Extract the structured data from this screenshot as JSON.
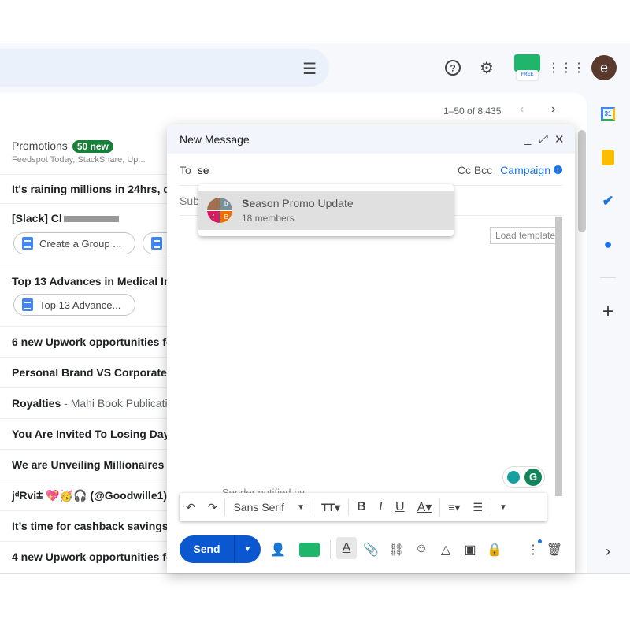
{
  "header": {
    "pager": "1–50 of 8,435",
    "avatar_letter": "e",
    "ext_badge": "FREE"
  },
  "promotions": {
    "label": "Promotions",
    "badge": "50 new",
    "senders": "Feedspot Today, StackShare, Up..."
  },
  "emails": [
    {
      "subject": "It's raining millions in 24hrs, d",
      "snippet": ""
    },
    {
      "subject": "[Slack] Cl",
      "snippet": "",
      "chips": [
        "Create a Group ...",
        ""
      ]
    },
    {
      "subject": "Top 13 Advances in Medical Im",
      "snippet": "",
      "chips": [
        "Top 13 Advance..."
      ]
    },
    {
      "subject": "6 new Upwork opportunities fo",
      "snippet": ""
    },
    {
      "subject": "Personal Brand VS Corporate B",
      "snippet": ""
    },
    {
      "subject": "Royalties",
      "snippet": " - Mahi Book Publicatio"
    },
    {
      "subject": "You Are Invited To Losing Dayl",
      "snippet": ""
    },
    {
      "subject": "We are Unveiling Millionaires i",
      "snippet": ""
    },
    {
      "subject": "jᵈRvi⩲ 💖🥳🎧 (@Goodwille1)",
      "snippet": ""
    },
    {
      "subject": "It’s time for cashback savings",
      "snippet": ""
    },
    {
      "subject": "4 new Upwork opportunities fo",
      "snippet": ""
    }
  ],
  "compose": {
    "title": "New Message",
    "to_label": "To",
    "to_value": "se",
    "cc_bcc": "Cc Bcc",
    "campaign": "Campaign",
    "subject_placeholder": "Subject",
    "load_template": "Load template",
    "notified": "Sender notified by",
    "font": "Sans Serif",
    "send": "Send"
  },
  "suggestion": {
    "match": "Se",
    "rest": "ason Promo Update",
    "members": "18 members",
    "avatar_letters": [
      "b",
      "f",
      "B"
    ]
  },
  "colors": {
    "send": "#0b57d0",
    "badge": "#188038",
    "accent": "#1a73e8"
  }
}
